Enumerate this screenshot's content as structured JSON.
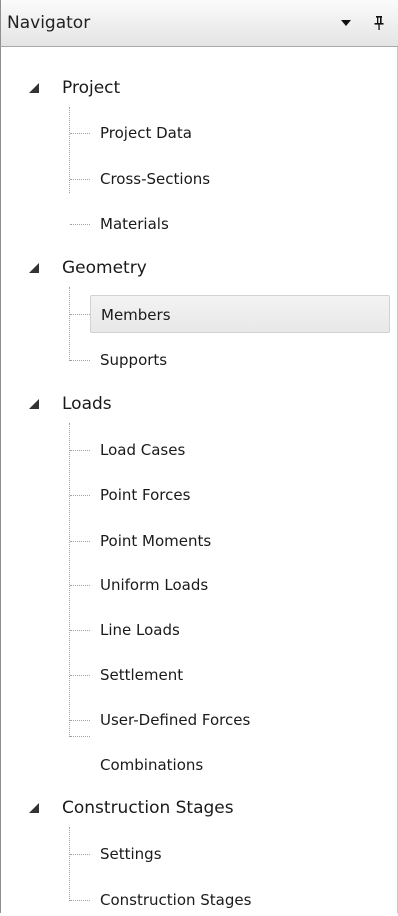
{
  "navigator": {
    "title": "Navigator",
    "dropdown_icon": "dropdown-arrow-icon",
    "pin_icon": "pin-icon"
  },
  "tree": {
    "selected_item": "Members",
    "groups": [
      {
        "label": "Project",
        "expanded": true,
        "items": [
          "Project Data",
          "Cross-Sections",
          "Materials"
        ]
      },
      {
        "label": "Geometry",
        "expanded": true,
        "items": [
          "Members",
          "Supports"
        ]
      },
      {
        "label": "Loads",
        "expanded": true,
        "items": [
          "Load Cases",
          "Point Forces",
          "Point Moments",
          "Uniform Loads",
          "Line Loads",
          "Settlement",
          "User-Defined Forces",
          "Combinations"
        ]
      },
      {
        "label": "Construction Stages",
        "expanded": true,
        "items": [
          "Settings",
          "Construction Stages"
        ]
      }
    ]
  },
  "colors": {
    "title_bar_top": "#fbfbfb",
    "title_bar_bottom": "#e4e4e4",
    "selection_background": "#ececec",
    "selection_border": "#d2d2d2",
    "tree_lines": "#a0a0a0",
    "expander": "#333333"
  }
}
